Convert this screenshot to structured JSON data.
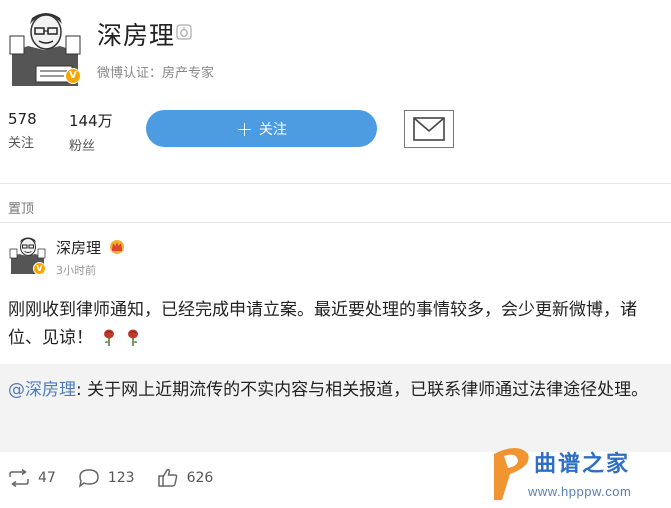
{
  "profile": {
    "name": "深房理",
    "verification": "微博认证：房产专家",
    "badge_letter": "V",
    "stats": {
      "following_count": "578",
      "following_label": "关注",
      "followers_count": "144万",
      "followers_label": "粉丝"
    },
    "follow_button_label": "关注"
  },
  "pinned_label": "置顶",
  "post": {
    "author": "深房理",
    "time": "3小时前",
    "text": "刚刚收到律师通知，已经完成申请立案。最近要处理的事情较多，会少更新微博，诸位、见谅！",
    "quote": {
      "mention": "@深房理",
      "text": ": 关于网上近期流传的不实内容与相关报道，已联系律师通过法律途径处理。"
    },
    "actions": {
      "repost_count": "47",
      "comment_count": "123",
      "like_count": "626"
    }
  },
  "watermark": {
    "brand": "曲谱之家",
    "url": "www.hpppw.com"
  },
  "colors": {
    "accent": "#4d9be0",
    "mention": "#4f7bbb",
    "verified_badge": "#f7a600",
    "rose": "#c0392b"
  }
}
